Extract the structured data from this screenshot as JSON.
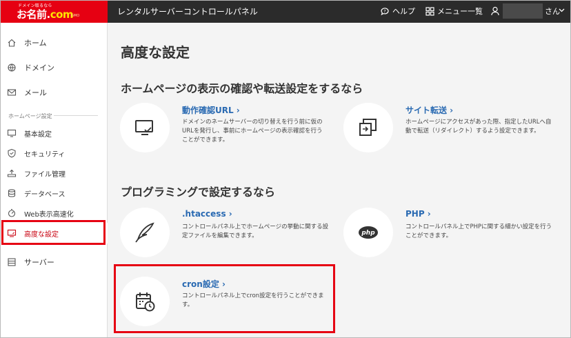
{
  "header": {
    "logo_tagline": "ドメイン取るなら",
    "logo_text": "お名前.",
    "logo_dotcom": "com",
    "logo_sub": "GMO",
    "app_title": "レンタルサーバーコントロールパネル",
    "help_label": "ヘルプ",
    "menu_label": "メニュー一覧",
    "user_suffix": "さん"
  },
  "sidebar": {
    "items_top": [
      {
        "label": "ホーム",
        "icon": "home-icon"
      },
      {
        "label": "ドメイン",
        "icon": "globe-icon"
      },
      {
        "label": "メール",
        "icon": "mail-icon"
      }
    ],
    "section_label": "ホームページ設定",
    "items_section": [
      {
        "label": "基本設定",
        "icon": "monitor-icon"
      },
      {
        "label": "セキュリティ",
        "icon": "shield-icon"
      },
      {
        "label": "ファイル管理",
        "icon": "folder-upload-icon"
      },
      {
        "label": "データベース",
        "icon": "database-icon"
      },
      {
        "label": "Web表示高速化",
        "icon": "speed-icon"
      },
      {
        "label": "高度な設定",
        "icon": "advanced-monitor-icon"
      }
    ],
    "item_server": {
      "label": "サーバー",
      "icon": "server-icon"
    }
  },
  "main": {
    "page_title": "高度な設定",
    "section1_title": "ホームページの表示の確認や転送設定をするなら",
    "section2_title": "プログラミングで設定するなら",
    "cards": {
      "operation_url": {
        "title": "動作確認URL ›",
        "desc": "ドメインのネームサーバーの切り替えを行う前に仮のURLを発行し、事前にホームページの表示確認を行うことができます。"
      },
      "site_redirect": {
        "title": "サイト転送 ›",
        "desc": "ホームページにアクセスがあった際、指定したURLへ自動で転送（リダイレクト）するよう設定できます。"
      },
      "htaccess": {
        "title": ".htaccess ›",
        "desc": "コントロールパネル上でホームページの挙動に関する設定ファイルを編集できます。"
      },
      "php": {
        "title": "PHP ›",
        "desc": "コントロールパネル上でPHPに関する細かい設定を行うことができます。",
        "icon_text": "php"
      },
      "cron": {
        "title": "cron設定 ›",
        "desc": "コントロールパネル上でcron設定を行うことができます。"
      }
    }
  },
  "colors": {
    "header_bg": "#2b2b2b",
    "logo_bg": "#e60012",
    "link": "#2a6ab2",
    "highlight": "#e60012"
  }
}
